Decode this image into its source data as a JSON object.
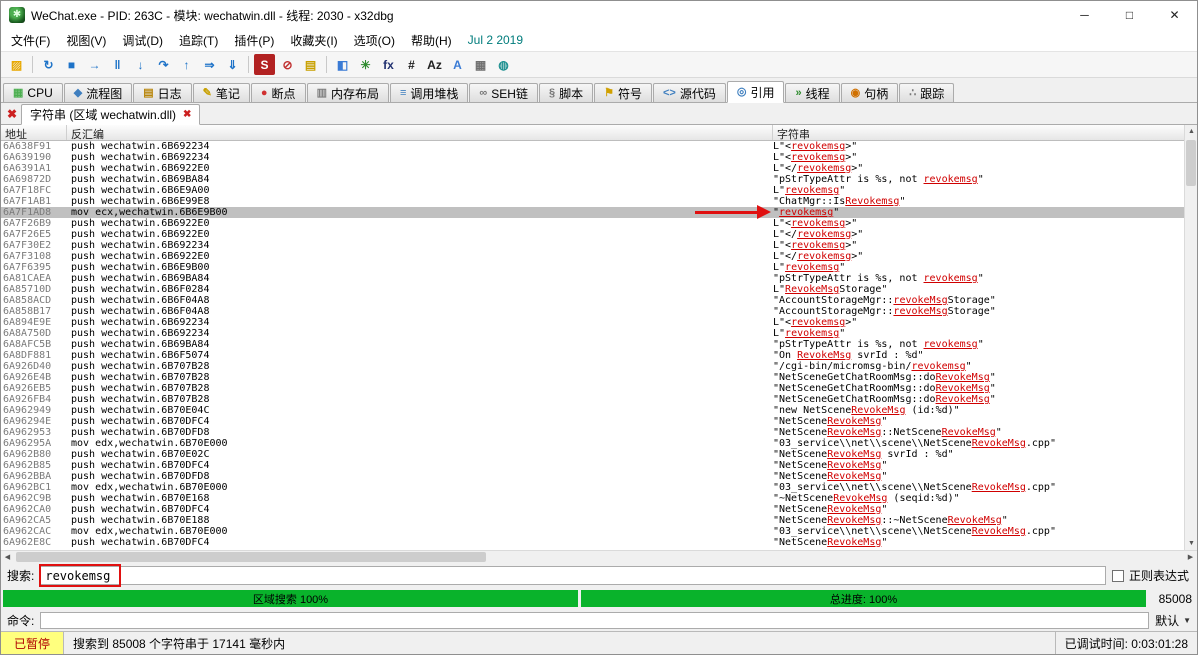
{
  "window": {
    "title": "WeChat.exe - PID: 263C - 模块: wechatwin.dll - 线程: 2030 - x32dbg",
    "controls": {
      "minimize": "─",
      "maximize": "□",
      "close": "✕"
    }
  },
  "menu": {
    "items": [
      "文件(F)",
      "视图(V)",
      "调试(D)",
      "追踪(T)",
      "插件(P)",
      "收藏夹(I)",
      "选项(O)",
      "帮助(H)"
    ],
    "build_date": "Jul 2 2019"
  },
  "toolbar": {
    "icons": [
      {
        "name": "open-file-icon",
        "glyph": "▨",
        "color": "#e8a800"
      },
      {
        "sep": true
      },
      {
        "name": "restart-icon",
        "glyph": "↻",
        "color": "#1e73c8"
      },
      {
        "name": "stop-icon",
        "glyph": "■",
        "color": "#1e73c8"
      },
      {
        "name": "run-icon",
        "glyph": "→",
        "color": "#1e73c8"
      },
      {
        "name": "pause-icon",
        "glyph": "‖",
        "color": "#1e73c8"
      },
      {
        "name": "step-into-icon",
        "glyph": "↓",
        "color": "#1e73c8"
      },
      {
        "name": "step-over-icon",
        "glyph": "↷",
        "color": "#1e73c8"
      },
      {
        "name": "execute-till-return-icon",
        "glyph": "↑",
        "color": "#1e73c8"
      },
      {
        "name": "run-to-user-code-icon",
        "glyph": "⇒",
        "color": "#1e73c8"
      },
      {
        "name": "animate-into-icon",
        "glyph": "⇓",
        "color": "#1e73c8"
      },
      {
        "sep": true
      },
      {
        "name": "settings-icon",
        "glyph": "S",
        "color": "#ffffff",
        "bg": "#b22222"
      },
      {
        "name": "disable-breakpoint-icon",
        "glyph": "⊘",
        "color": "#c03030"
      },
      {
        "name": "log-window-icon",
        "glyph": "▤",
        "color": "#c8a000"
      },
      {
        "sep": true
      },
      {
        "name": "patch-icon",
        "glyph": "◧",
        "color": "#3a7bd5"
      },
      {
        "name": "gear-icon",
        "glyph": "✳",
        "color": "#2e8b2e"
      },
      {
        "name": "fx-icon",
        "glyph": "fx",
        "color": "#203070"
      },
      {
        "name": "hash-icon",
        "glyph": "#",
        "color": "#202020"
      },
      {
        "name": "az-icon",
        "glyph": "Az",
        "color": "#202020"
      },
      {
        "name": "font-icon",
        "glyph": "A",
        "color": "#3a7bd5"
      },
      {
        "name": "memory-icon",
        "glyph": "▦",
        "color": "#707070"
      },
      {
        "name": "globe-icon",
        "glyph": "◍",
        "color": "#1e9090"
      }
    ]
  },
  "tabs": {
    "active": "引用",
    "items": [
      {
        "label": "CPU",
        "name": "tab-cpu",
        "icon": "cpu-icon",
        "glyph": "▦",
        "color": "#4caf50"
      },
      {
        "label": "流程图",
        "name": "tab-graph",
        "icon": "graph-icon",
        "glyph": "◆",
        "color": "#3f7fbf"
      },
      {
        "label": "日志",
        "name": "tab-log",
        "icon": "log-icon",
        "glyph": "▤",
        "color": "#b8860b"
      },
      {
        "label": "笔记",
        "name": "tab-notes",
        "icon": "notes-icon",
        "glyph": "✎",
        "color": "#c8a000"
      },
      {
        "label": "断点",
        "name": "tab-breakpoints",
        "icon": "breakpoint-icon",
        "glyph": "●",
        "color": "#d03030"
      },
      {
        "label": "内存布局",
        "name": "tab-memory-map",
        "icon": "memory-map-icon",
        "glyph": "▥",
        "color": "#808080"
      },
      {
        "label": "调用堆栈",
        "name": "tab-call-stack",
        "icon": "call-stack-icon",
        "glyph": "≡",
        "color": "#3f7fbf"
      },
      {
        "label": "SEH链",
        "name": "tab-seh",
        "icon": "seh-chain-icon",
        "glyph": "∞",
        "color": "#777777"
      },
      {
        "label": "脚本",
        "name": "tab-script",
        "icon": "script-icon",
        "glyph": "§",
        "color": "#777777"
      },
      {
        "label": "符号",
        "name": "tab-symbols",
        "icon": "symbols-icon",
        "glyph": "⚑",
        "color": "#d0a000"
      },
      {
        "label": "源代码",
        "name": "tab-source",
        "icon": "source-icon",
        "glyph": "<>",
        "color": "#3f7fbf"
      },
      {
        "label": "引用",
        "name": "tab-references",
        "icon": "references-magnifier-icon",
        "glyph": "◎",
        "color": "#3f7fbf"
      },
      {
        "label": "线程",
        "name": "tab-threads",
        "icon": "threads-icon",
        "glyph": "»",
        "color": "#2e8b2e"
      },
      {
        "label": "句柄",
        "name": "tab-handles",
        "icon": "handles-icon",
        "glyph": "◉",
        "color": "#d07000"
      },
      {
        "label": "跟踪",
        "name": "tab-trace",
        "icon": "trace-icon",
        "glyph": "∴",
        "color": "#777777"
      }
    ]
  },
  "doc_tab": {
    "label": "字符串 (区域 wechatwin.dll)",
    "close_glyph": "✖"
  },
  "table": {
    "columns": [
      "地址",
      "反汇编",
      "字符串"
    ],
    "selected_index": 6,
    "rows": [
      {
        "addr": "6A638F91",
        "disasm": "push wechatwin.6B692234",
        "str": "L\"<revokemsg>\""
      },
      {
        "addr": "6A639190",
        "disasm": "push wechatwin.6B692234",
        "str": "L\"<revokemsg>\""
      },
      {
        "addr": "6A6391A1",
        "disasm": "push wechatwin.6B6922E0",
        "str": "L\"</revokemsg>\""
      },
      {
        "addr": "6A69872D",
        "disasm": "push wechatwin.6B69BA84",
        "str": "\"pStrTypeAttr is %s, not revokemsg\""
      },
      {
        "addr": "6A7F18FC",
        "disasm": "push wechatwin.6B6E9A00",
        "str": "L\"revokemsg\""
      },
      {
        "addr": "6A7F1AB1",
        "disasm": "push wechatwin.6B6E99E8",
        "str": "\"ChatMgr::IsRevokemsg\""
      },
      {
        "addr": "6A7F1AD8",
        "disasm": "mov ecx,wechatwin.6B6E9B00",
        "str": "\"revokemsg\""
      },
      {
        "addr": "6A7F26B9",
        "disasm": "push wechatwin.6B6922E0",
        "str": "L\"<revokemsg>\""
      },
      {
        "addr": "6A7F26E5",
        "disasm": "push wechatwin.6B6922E0",
        "str": "L\"</revokemsg>\""
      },
      {
        "addr": "6A7F30E2",
        "disasm": "push wechatwin.6B692234",
        "str": "L\"<revokemsg>\""
      },
      {
        "addr": "6A7F3108",
        "disasm": "push wechatwin.6B6922E0",
        "str": "L\"</revokemsg>\""
      },
      {
        "addr": "6A7F6395",
        "disasm": "push wechatwin.6B6E9B00",
        "str": "L\"revokemsg\""
      },
      {
        "addr": "6A81CAEA",
        "disasm": "push wechatwin.6B69BA84",
        "str": "\"pStrTypeAttr is %s, not revokemsg\""
      },
      {
        "addr": "6A85710D",
        "disasm": "push wechatwin.6B6F0284",
        "str": "L\"RevokeMsgStorage\""
      },
      {
        "addr": "6A858ACD",
        "disasm": "push wechatwin.6B6F04A8",
        "str": "\"AccountStorageMgr::revokeMsgStorage\""
      },
      {
        "addr": "6A858B17",
        "disasm": "push wechatwin.6B6F04A8",
        "str": "\"AccountStorageMgr::revokeMsgStorage\""
      },
      {
        "addr": "6A894E9E",
        "disasm": "push wechatwin.6B692234",
        "str": "L\"<revokemsg>\""
      },
      {
        "addr": "6A8A750D",
        "disasm": "push wechatwin.6B692234",
        "str": "L\"revokemsg\""
      },
      {
        "addr": "6A8AFC5B",
        "disasm": "push wechatwin.6B69BA84",
        "str": "\"pStrTypeAttr is %s, not revokemsg\""
      },
      {
        "addr": "6A8DF881",
        "disasm": "push wechatwin.6B6F5074",
        "str": "\"On RevokeMsg svrId : %d\""
      },
      {
        "addr": "6A926D40",
        "disasm": "push wechatwin.6B707B28",
        "str": "\"/cgi-bin/micromsg-bin/revokemsg\""
      },
      {
        "addr": "6A926E4B",
        "disasm": "push wechatwin.6B707B28",
        "str": "\"NetSceneGetChatRoomMsg::doRevokeMsg\""
      },
      {
        "addr": "6A926EB5",
        "disasm": "push wechatwin.6B707B28",
        "str": "\"NetSceneGetChatRoomMsg::doRevokeMsg\""
      },
      {
        "addr": "6A926FB4",
        "disasm": "push wechatwin.6B707B28",
        "str": "\"NetSceneGetChatRoomMsg::doRevokeMsg\""
      },
      {
        "addr": "6A962949",
        "disasm": "push wechatwin.6B70E04C",
        "str": "\"new NetSceneRevokeMsg (id:%d)\""
      },
      {
        "addr": "6A96294E",
        "disasm": "push wechatwin.6B70DFC4",
        "str": "\"NetSceneRevokeMsg\""
      },
      {
        "addr": "6A962953",
        "disasm": "push wechatwin.6B70DFD8",
        "str": "\"NetSceneRevokeMsg::NetSceneRevokeMsg\""
      },
      {
        "addr": "6A96295A",
        "disasm": "mov edx,wechatwin.6B70E000",
        "str": "\"03_service\\\\net\\\\scene\\\\NetSceneRevokeMsg.cpp\""
      },
      {
        "addr": "6A962B80",
        "disasm": "push wechatwin.6B70E02C",
        "str": "\"NetSceneRevokeMsg svrId : %d\""
      },
      {
        "addr": "6A962B85",
        "disasm": "push wechatwin.6B70DFC4",
        "str": "\"NetSceneRevokeMsg\""
      },
      {
        "addr": "6A962BBA",
        "disasm": "push wechatwin.6B70DFD8",
        "str": "\"NetSceneRevokeMsg\""
      },
      {
        "addr": "6A962BC1",
        "disasm": "mov edx,wechatwin.6B70E000",
        "str": "\"03_service\\\\net\\\\scene\\\\NetSceneRevokeMsg.cpp\""
      },
      {
        "addr": "6A962C9B",
        "disasm": "push wechatwin.6B70E168",
        "str": "\"~NetSceneRevokeMsg (seqid:%d)\""
      },
      {
        "addr": "6A962CA0",
        "disasm": "push wechatwin.6B70DFC4",
        "str": "\"NetSceneRevokeMsg\""
      },
      {
        "addr": "6A962CA5",
        "disasm": "push wechatwin.6B70E188",
        "str": "\"NetSceneRevokeMsg::~NetSceneRevokeMsg\""
      },
      {
        "addr": "6A962CAC",
        "disasm": "mov edx,wechatwin.6B70E000",
        "str": "\"03_service\\\\net\\\\scene\\\\NetSceneRevokeMsg.cpp\""
      },
      {
        "addr": "6A962E8C",
        "disasm": "push wechatwin.6B70DFC4",
        "str": "\"NetSceneRevokeMsg\""
      }
    ]
  },
  "search": {
    "label": "搜索:",
    "value": "revokemsg",
    "term": "revokemsg",
    "regex_label": "正则表达式",
    "regex_checked": false
  },
  "progress": {
    "left_label": "区域搜索 100%",
    "right_label": "总进度: 100%",
    "count": "85008"
  },
  "command": {
    "label": "命令:",
    "value": "",
    "profile": "默认"
  },
  "status": {
    "state": "已暂停",
    "message": "搜索到 85008 个字符串于 17141 毫秒内",
    "debug_time": "已调试时间: 0:03:01:28"
  },
  "colors": {
    "match_red": "#d00000",
    "annotation_red": "#e01010",
    "selection_gray": "#c0c0c0",
    "progress_green": "#09b32b",
    "paused_yellow": "#ffff7e"
  }
}
